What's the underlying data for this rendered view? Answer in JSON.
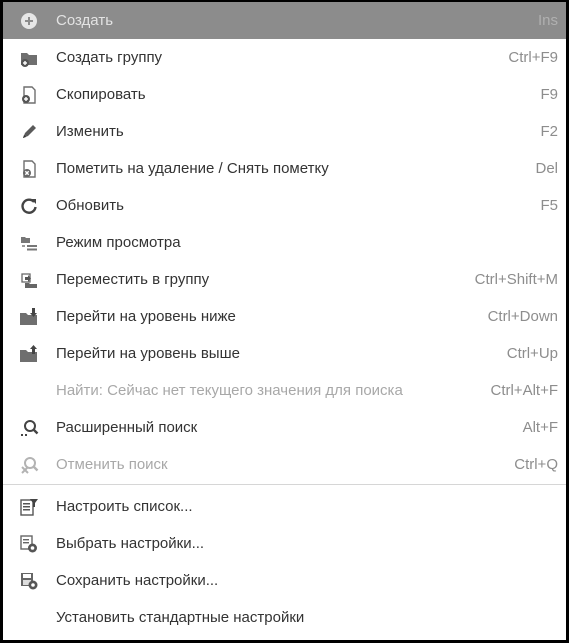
{
  "menu": {
    "items": [
      {
        "label": "Создать",
        "shortcut": "Ins",
        "icon": "plus-circle-icon"
      },
      {
        "label": "Создать группу",
        "shortcut": "Ctrl+F9",
        "icon": "folder-add-icon"
      },
      {
        "label": "Скопировать",
        "shortcut": "F9",
        "icon": "copy-document-icon"
      },
      {
        "label": "Изменить",
        "shortcut": "F2",
        "icon": "pencil-icon"
      },
      {
        "label": "Пометить на удаление / Снять пометку",
        "shortcut": "Del",
        "icon": "mark-delete-icon"
      },
      {
        "label": "Обновить",
        "shortcut": "F5",
        "icon": "refresh-icon"
      },
      {
        "label": "Режим просмотра",
        "shortcut": "",
        "icon": "view-mode-icon"
      },
      {
        "label": "Переместить в группу",
        "shortcut": "Ctrl+Shift+M",
        "icon": "move-to-group-icon"
      },
      {
        "label": "Перейти на уровень ниже",
        "shortcut": "Ctrl+Down",
        "icon": "folder-down-icon"
      },
      {
        "label": "Перейти на уровень выше",
        "shortcut": "Ctrl+Up",
        "icon": "folder-up-icon"
      },
      {
        "label": "Найти: Сейчас нет текущего значения для поиска",
        "shortcut": "Ctrl+Alt+F",
        "icon": "none"
      },
      {
        "label": "Расширенный поиск",
        "shortcut": "Alt+F",
        "icon": "advanced-search-icon"
      },
      {
        "label": "Отменить поиск",
        "shortcut": "Ctrl+Q",
        "icon": "cancel-search-icon"
      },
      {
        "label": "Настроить список...",
        "shortcut": "",
        "icon": "list-settings-icon"
      },
      {
        "label": "Выбрать настройки...",
        "shortcut": "",
        "icon": "choose-settings-icon"
      },
      {
        "label": "Сохранить настройки...",
        "shortcut": "",
        "icon": "save-settings-icon"
      },
      {
        "label": "Установить стандартные настройки",
        "shortcut": "",
        "icon": "none"
      }
    ]
  },
  "colors": {
    "highlight_bg": "#8c8c8c",
    "text": "#333333",
    "disabled_text": "#a8a8a8",
    "shortcut_text": "#8d8d8d",
    "separator": "#d6d6d6"
  }
}
